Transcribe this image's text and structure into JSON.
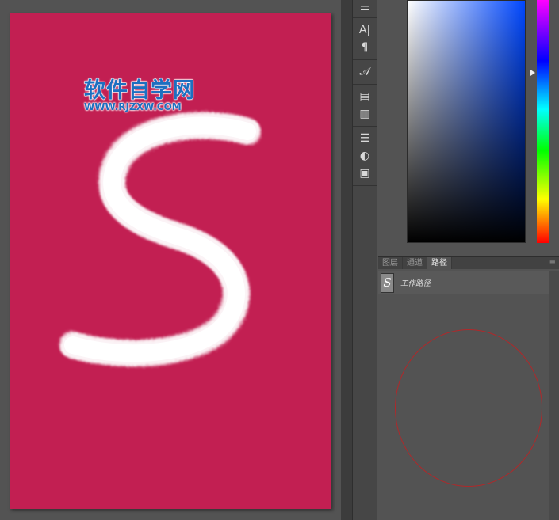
{
  "watermark": {
    "cn": "软件自学网",
    "en": "WWW.RJZXW.COM"
  },
  "canvas": {
    "doc_color": "#c21f52",
    "artwork_letter": "S",
    "artwork_style": "white fur"
  },
  "toolbar": {
    "icons": [
      "brush-settings-icon",
      "character-icon",
      "paragraph-icon",
      "glyphs-icon",
      "properties-icon",
      "notes-icon",
      "adjustments-icon",
      "styles-icon",
      "swatches-icon"
    ],
    "glyphs": {
      "character": "A|",
      "paragraph": "¶",
      "glyphs": "𝒜",
      "properties": "▤",
      "notes": "▥",
      "adjustments": "☰",
      "styles": "◐",
      "swatches": "▣"
    }
  },
  "color_picker": {
    "hue_color": "#0047ff"
  },
  "panel": {
    "tabs": [
      {
        "label": "图层"
      },
      {
        "label": "通道"
      },
      {
        "label": "路径",
        "active": true
      }
    ],
    "menu_glyph": "≡",
    "paths": [
      {
        "name": "工作路径",
        "thumb": "S"
      }
    ]
  },
  "overlay": {
    "circle_color": "#b0282a"
  }
}
